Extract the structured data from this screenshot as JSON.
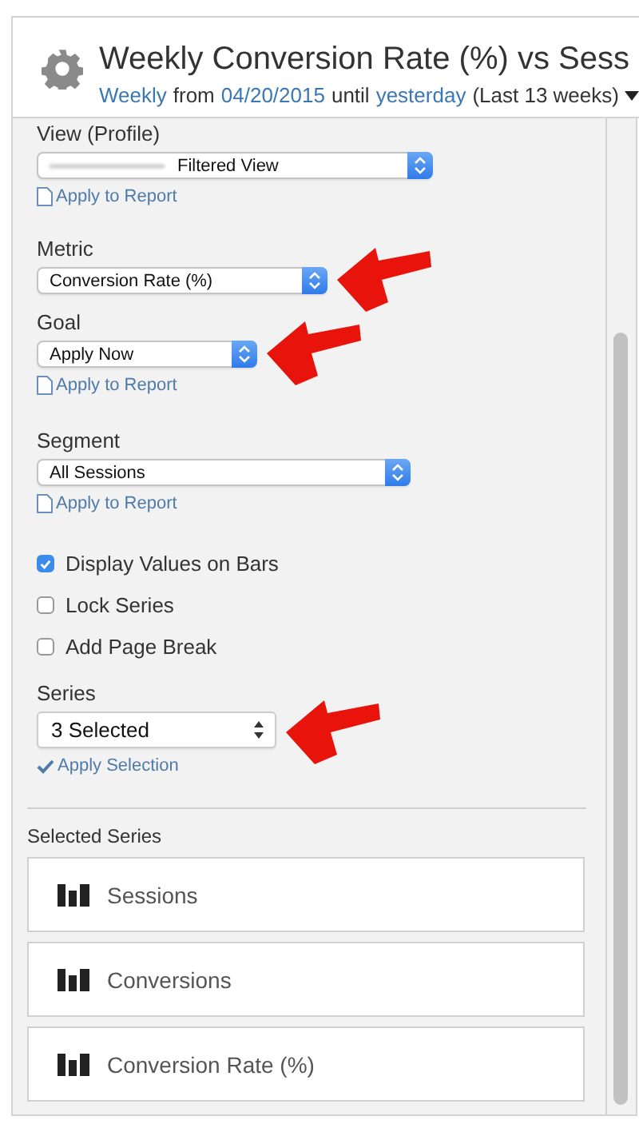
{
  "header": {
    "title": "Weekly Conversion Rate (%) vs Sess",
    "interval": "Weekly",
    "from_word": "from",
    "start_date": "04/20/2015",
    "until_word": "until",
    "end": "yesterday",
    "range": "(Last 13 weeks)"
  },
  "settings": [
    {
      "kind": "select",
      "label": "View (Profile)",
      "value": "Filtered View",
      "redacted": true,
      "annotated": false,
      "link": {
        "kind": "report",
        "text": "Apply to Report"
      }
    },
    {
      "kind": "select",
      "label": "Metric",
      "value": "Conversion Rate (%)",
      "redacted": false,
      "annotated": true
    },
    {
      "kind": "select",
      "label": "Goal",
      "value": "Apply Now",
      "redacted": false,
      "annotated": true,
      "link": {
        "kind": "report",
        "text": "Apply to Report"
      }
    },
    {
      "kind": "select",
      "label": "Segment",
      "value": "All Sessions",
      "redacted": false,
      "annotated": false,
      "link": {
        "kind": "report",
        "text": "Apply to Report"
      }
    },
    {
      "kind": "checkbox",
      "label": "Display Values on Bars",
      "checked": true
    },
    {
      "kind": "checkbox",
      "label": "Lock Series",
      "checked": false
    },
    {
      "kind": "checkbox",
      "label": "Add Page Break",
      "checked": false
    },
    {
      "kind": "select",
      "label": "Series",
      "value": "3 Selected",
      "redacted": false,
      "annotated": true,
      "link": {
        "kind": "selection",
        "text": "Apply Selection"
      }
    }
  ],
  "selected_series": {
    "title": "Selected Series",
    "items": [
      "Sessions",
      "Conversions",
      "Conversion Rate (%)"
    ]
  }
}
